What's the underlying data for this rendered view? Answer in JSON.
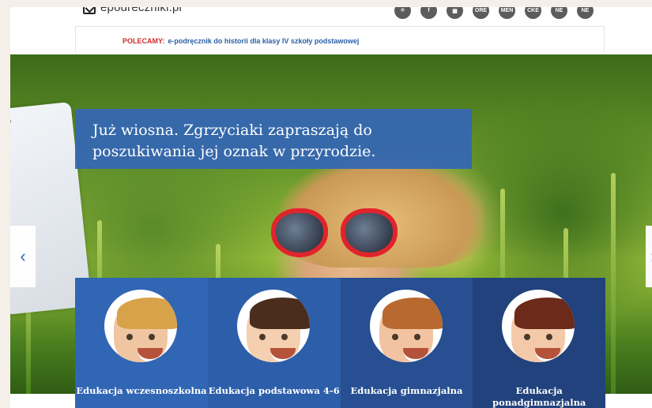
{
  "header": {
    "logo_text": "epodreczniki.pl",
    "social_icons": [
      "icon-1",
      "icon-2",
      "icon-3",
      "ORE",
      "MEN",
      "CKE",
      "NE",
      "NE"
    ]
  },
  "recommend": {
    "label": "POLECAMY:",
    "text": "e-podręcznik do historii dla klasy IV szkoły podstawowej"
  },
  "hero": {
    "headline": "Już wiosna. Zgrzyciaki zapraszają do poszukiwania jej oznak w przyrodzie.",
    "prev_arrow": "‹",
    "next_arrow": "›"
  },
  "tiles": [
    {
      "label": "Edukacja wczesnoszkolna"
    },
    {
      "label": "Edukacja podstawowa 4-6"
    },
    {
      "label": "Edukacja gimnazjalna"
    },
    {
      "label": "Edukacja ponadgimnazjalna"
    }
  ]
}
